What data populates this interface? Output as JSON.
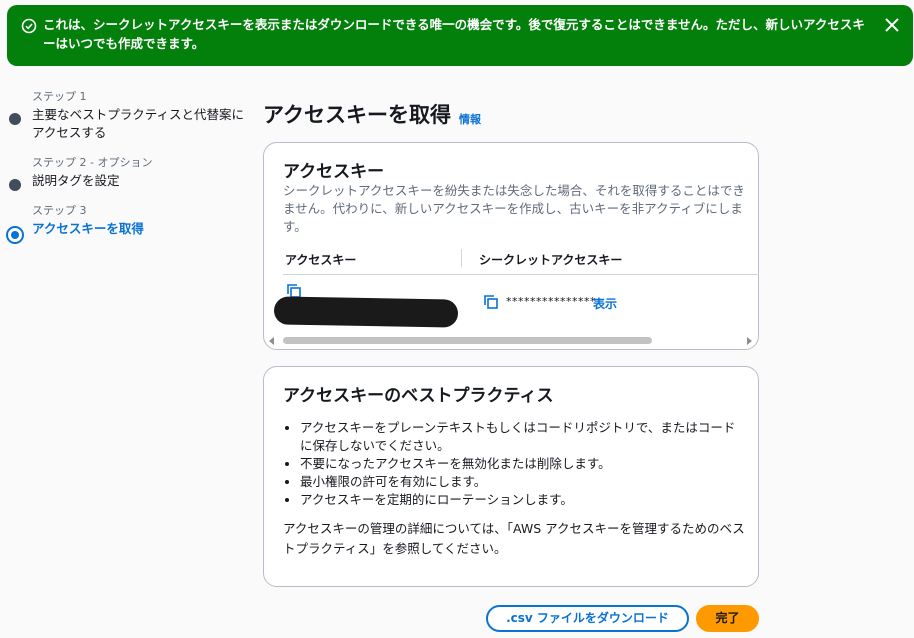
{
  "flash": {
    "message": "これは、シークレットアクセスキーを表示またはダウンロードできる唯一の機会です。後で復元することはできません。ただし、新しいアクセスキーはいつでも作成できます。",
    "icon": "success-check-icon",
    "close_icon": "close-icon",
    "color": "#037f0c"
  },
  "steps": [
    {
      "number": "ステップ 1",
      "title": "主要なベストプラクティスと代替案にアクセスする",
      "state": "complete"
    },
    {
      "number": "ステップ 2 - オプション",
      "title": "説明タグを設定",
      "state": "complete"
    },
    {
      "number": "ステップ 3",
      "title": "アクセスキーを取得",
      "state": "active"
    }
  ],
  "page": {
    "title": "アクセスキーを取得",
    "info_link": "情報"
  },
  "access_key_card": {
    "title": "アクセスキー",
    "description": "シークレットアクセスキーを紛失または失念した場合、それを取得することはできません。代わりに、新しいアクセスキーを作成し、古いキーを非アクティブにします。",
    "columns": [
      "アクセスキー",
      "シークレットアクセスキー"
    ],
    "secret_masked": "***************",
    "show_label": "表示"
  },
  "best_practices_card": {
    "title": "アクセスキーのベストプラクティス",
    "items": [
      "アクセスキーをプレーンテキストもしくはコードリポジトリで、またはコードに保存しないでください。",
      "不要になったアクセスキーを無効化または削除します。",
      "最小権限の許可を有効にします。",
      "アクセスキーを定期的にローテーションします。"
    ],
    "footer": "アクセスキーの管理の詳細については、「AWS アクセスキーを管理するためのベストプラクティス」を参照してください。"
  },
  "actions": {
    "download_csv": ".csv ファイルをダウンロード",
    "done": "完了"
  },
  "colors": {
    "link": "#0972d3",
    "primary_button": "#ff9900"
  }
}
